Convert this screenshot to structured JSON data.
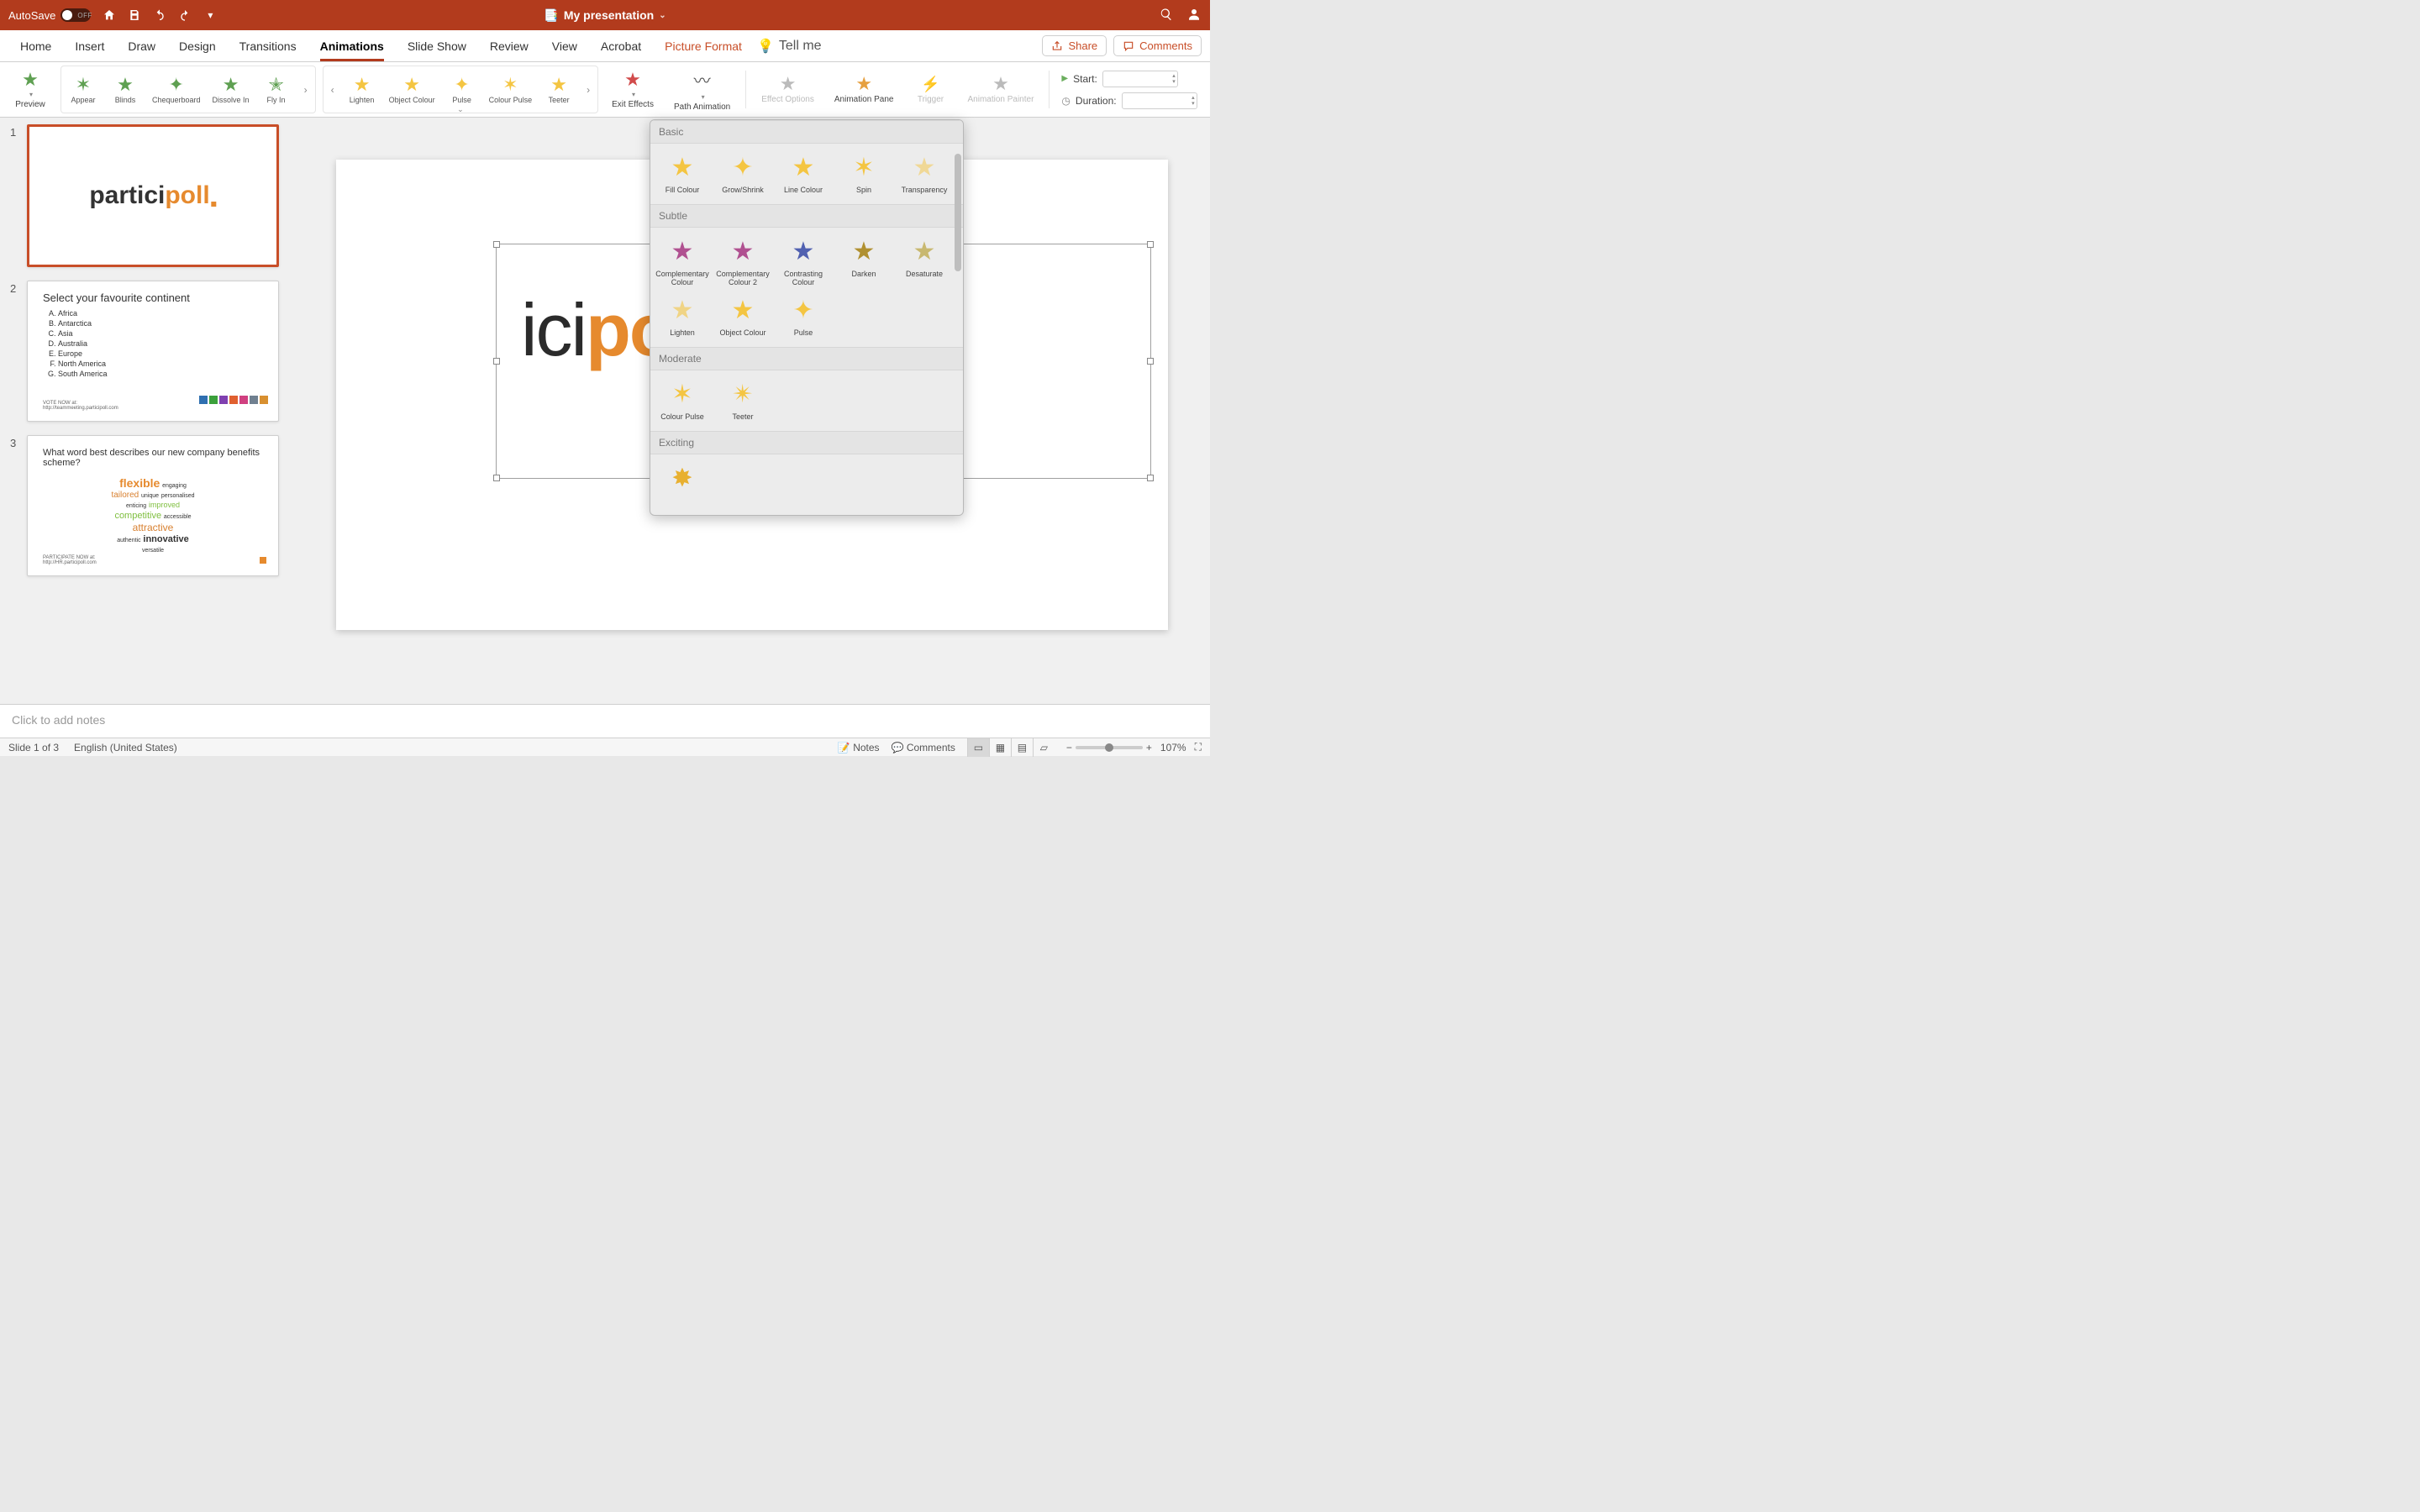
{
  "titlebar": {
    "autosave": "AutoSave",
    "toggle": "OFF",
    "doc_icon": "📄",
    "doc_title": "My presentation"
  },
  "tabs": {
    "home": "Home",
    "insert": "Insert",
    "draw": "Draw",
    "design": "Design",
    "transitions": "Transitions",
    "animations": "Animations",
    "slideshow": "Slide Show",
    "review": "Review",
    "view": "View",
    "acrobat": "Acrobat",
    "picformat": "Picture Format",
    "tellme": "Tell me",
    "share": "Share",
    "comments": "Comments"
  },
  "ribbon": {
    "preview": "Preview",
    "entrance": [
      "Appear",
      "Blinds",
      "Chequerboard",
      "Dissolve In",
      "Fly In"
    ],
    "emphasis": [
      "Lighten",
      "Object Colour",
      "Pulse",
      "Colour Pulse",
      "Teeter"
    ],
    "exit": "Exit Effects",
    "path": "Path Animation",
    "effectopts": "Effect Options",
    "animpane": "Animation Pane",
    "trigger": "Trigger",
    "animpainter": "Animation Painter",
    "start_lbl": "Start:",
    "duration_lbl": "Duration:"
  },
  "gallery": {
    "basic_h": "Basic",
    "basic": [
      "Fill Colour",
      "Grow/Shrink",
      "Line Colour",
      "Spin",
      "Transparency"
    ],
    "subtle_h": "Subtle",
    "subtle1": [
      "Complementary Colour",
      "Complementary Colour 2",
      "Contrasting Colour",
      "Darken",
      "Desaturate"
    ],
    "subtle2": [
      "Lighten",
      "Object Colour",
      "Pulse"
    ],
    "moderate_h": "Moderate",
    "moderate": [
      "Colour Pulse",
      "Teeter"
    ],
    "exciting_h": "Exciting"
  },
  "slides": {
    "s1": {
      "logo_a": "partici",
      "logo_b": "poll"
    },
    "s2": {
      "title": "Select your favourite continent",
      "items": [
        "Africa",
        "Antarctica",
        "Asia",
        "Australia",
        "Europe",
        "North America",
        "South America"
      ],
      "vote": "VOTE NOW at:",
      "vote_url": "http://teammeeting.participoll.com"
    },
    "s3": {
      "q": "What word best describes our new company benefits scheme?",
      "words": {
        "flex": "flexible",
        "eng": "engaging",
        "tail": "tailored",
        "uniq": "unique",
        "pers": "personalised",
        "ent": "enticing",
        "imp": "improved",
        "comp": "competitive",
        "acc": "accessible",
        "attr": "attractive",
        "auth": "authentic",
        "inn": "innovative",
        "vers": "versatile"
      },
      "pp": "PARTICIPATE NOW at:",
      "pp_url": "http://HR.participoll.com"
    }
  },
  "canvas": {
    "logo_a": "partici",
    "logo_b": "po",
    "logo_c": "."
  },
  "notes_placeholder": "Click to add notes",
  "status": {
    "slide": "Slide 1 of 3",
    "lang": "English (United States)",
    "notes": "Notes",
    "comments": "Comments",
    "zoom": "107%"
  }
}
